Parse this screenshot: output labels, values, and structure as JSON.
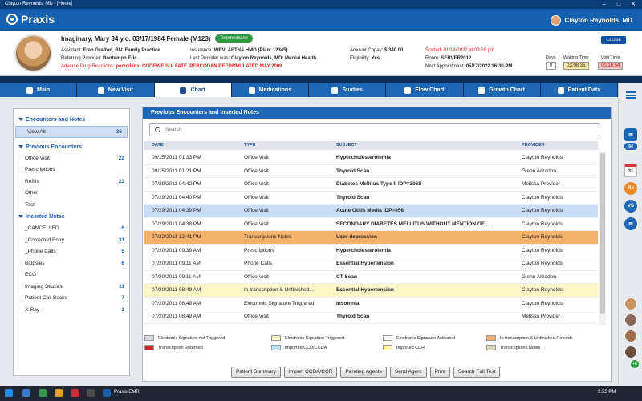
{
  "window": {
    "title": "Clayton Reynolds, MD - [Home]"
  },
  "app": {
    "name": "Praxis",
    "user": "Clayton Reynolds, MD"
  },
  "patient": {
    "name": "Imaginary, Mary 34 y.o. 03/17/1984 Female (M123)",
    "telemedicine": "Telemedicine",
    "assistant_label": "Assistant: ",
    "assistant": "Fran Grafton, RN: Family Practice",
    "referring_label": "Referring Provider: ",
    "referring": "Bontempo Eric",
    "adr_label": "Adverse Drug Reactions: ",
    "adr": "penicillins, CODEINE SULFATE, PERCODAN REFORMULATED MAY 2009",
    "insurance_label": "Insurance: ",
    "insurance": "WRV: AETNA HMO (Plan: 12345)",
    "lastprov_label": "Last Provider was: ",
    "lastprov": "Clayton Reynolds, MD: Mental Health",
    "copay_label": "Amount Copay: ",
    "copay": "$ 340.00",
    "elig_label": "Eligibility: ",
    "elig": "Yes",
    "started": "Started: 01/16/2022 at 03:35 pm",
    "room_label": "Room: ",
    "room": "SERVER2012",
    "nextappt_label": "Next Appointment: ",
    "nextappt": "05/17/2022 16:30 PM",
    "close": "CLOSE",
    "days_label": "Days",
    "days": "0",
    "wait_label": "Waiting Time",
    "wait": "03:08:35",
    "visit_label": "Visit Time",
    "visit": "00:10:54"
  },
  "tabs": [
    "Main",
    "New Visit",
    "Chart",
    "Medications",
    "Studies",
    "Flow Chart",
    "Growth Chart",
    "Patient Data"
  ],
  "sidebar": {
    "sections": [
      {
        "title": "Encounters and Notes",
        "items": [
          {
            "label": "View All",
            "count": "36"
          }
        ]
      },
      {
        "title": "Previous Encounters",
        "items": [
          {
            "label": "Office Visit",
            "count": "22"
          },
          {
            "label": "Prescriptions",
            "count": ""
          },
          {
            "label": "Refills",
            "count": "23"
          },
          {
            "label": "Other",
            "count": ""
          },
          {
            "label": "Test",
            "count": ""
          }
        ]
      },
      {
        "title": "Inserted Notes",
        "items": [
          {
            "label": "_CANCELLED",
            "count": "6"
          },
          {
            "label": "_Corrected Entry",
            "count": "31"
          },
          {
            "label": "_Phone Calls",
            "count": "5"
          },
          {
            "label": "Biopsies",
            "count": "6"
          },
          {
            "label": "ECG",
            "count": ""
          },
          {
            "label": "Imaging Studies",
            "count": "11"
          },
          {
            "label": "Patient Call Backs",
            "count": "7"
          },
          {
            "label": "X-Ray",
            "count": "3"
          }
        ]
      }
    ]
  },
  "content": {
    "header": "Previous Encounters and Inserted Notes",
    "search_placeholder": "Search",
    "columns": {
      "date": "DATE",
      "type": "TYPE",
      "subject": "SUBJECT",
      "provider": "PROVIDER"
    },
    "rows": [
      {
        "date": "09/15/2011 01:33 PM",
        "type": "Office Visit",
        "subject": "Hypercholesterolemia",
        "provider": "Clayton Reynolds",
        "hl": ""
      },
      {
        "date": "09/15/2011 01:21 PM",
        "type": "Office Visit",
        "subject": "Thyroid Scan",
        "provider": "Glenn Arzadon",
        "hl": ""
      },
      {
        "date": "07/29/2011 04:42 PM",
        "type": "Office Visit",
        "subject": "Diabetes Mellitus Type II IDP=3068",
        "provider": "Melissa Provider",
        "hl": ""
      },
      {
        "date": "07/29/2011 04:40 PM",
        "type": "Office Visit",
        "subject": "Thyroid Scan",
        "provider": "Clayton Reynolds",
        "hl": ""
      },
      {
        "date": "07/29/2011 04:39 PM",
        "type": "Office Visit",
        "subject": "Acute Otitis Media IDP=956",
        "provider": "Clayton Reynolds",
        "hl": "blue"
      },
      {
        "date": "07/29/2011 04:38 PM",
        "type": "Office Visit",
        "subject": "SECONDARY DIABETES MELLITUS WITHOUT MENTION OF ...",
        "provider": "Clayton Reynolds",
        "hl": ""
      },
      {
        "date": "07/22/2011 12:41 PM",
        "type": "Transcriptions Notes",
        "subject": "User depression",
        "provider": "Clayton Reynolds",
        "hl": "orange"
      },
      {
        "date": "07/20/2011 09:39 AM",
        "type": "Prescriptions",
        "subject": "Hypercholesterolemia",
        "provider": "Clayton Reynolds",
        "hl": ""
      },
      {
        "date": "07/20/2011 09:11 AM",
        "type": "Phone Calls",
        "subject": "Essential Hypertension",
        "provider": "Clayton Reynolds",
        "hl": ""
      },
      {
        "date": "07/20/2011 09:11 AM",
        "type": "Office Visit",
        "subject": "CT Scan",
        "provider": "Glenn Arzadon",
        "hl": ""
      },
      {
        "date": "07/20/2011 08:49 AM",
        "type": "In transcription & Unfinished...",
        "subject": "Essential Hypertension",
        "provider": "Clayton Reynolds",
        "hl": "yellow"
      },
      {
        "date": "07/20/2011 08:49 AM",
        "type": "Electronic Signature Triggered",
        "subject": "Insomnia",
        "provider": "Clayton Reynolds",
        "hl": ""
      },
      {
        "date": "07/20/2011 08:49 AM",
        "type": "Office Visit",
        "subject": "Thyroid Scan",
        "provider": "Melissa Provider",
        "hl": ""
      }
    ],
    "legend": [
      {
        "label": "Electronic Signature not Triggered",
        "color": "#d8dbe0"
      },
      {
        "label": "Electronic Signature Triggered",
        "color": "#fbf6c8"
      },
      {
        "label": "Electronic Signature Activated",
        "color": "#ffffff"
      },
      {
        "label": "In transcription & Unfinished Records",
        "color": "#f0b070"
      },
      {
        "label": "Transcription Returned",
        "color": "#c62828"
      },
      {
        "label": "Imported CCD/CCDA",
        "color": "#bfe0f5"
      },
      {
        "label": "Imported CCR",
        "color": "#fff59d"
      },
      {
        "label": "Transcriptions Notes",
        "color": "#d8d4b8"
      }
    ],
    "buttons": [
      "Patient Summary",
      "Import CCDA/CCR",
      "Pending Agents",
      "Send Agent",
      "Print",
      "Search Full Text"
    ]
  },
  "rail": {
    "mail_count": "64",
    "calendar_day": "31",
    "rx": "Rx",
    "vs": "VS",
    "more_count": "+6"
  },
  "taskbar": {
    "app": "Praxis EMR",
    "time": "2:55 PM"
  }
}
